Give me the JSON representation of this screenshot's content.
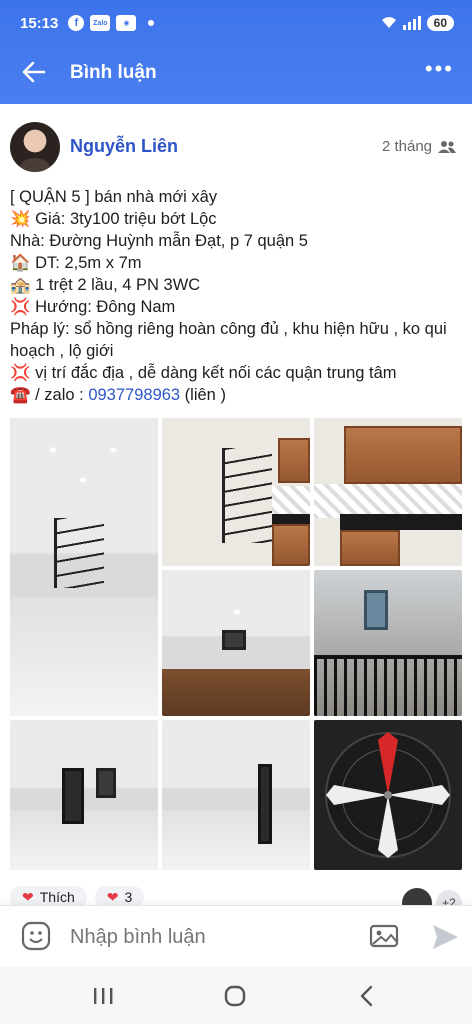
{
  "status": {
    "time": "15:13",
    "icons": [
      "facebook-icon",
      "zalo-icon",
      "camera-icon"
    ],
    "battery": "60"
  },
  "appbar": {
    "title": "Bình luận"
  },
  "post": {
    "author": "Nguyễn Liên",
    "time": "2 tháng",
    "lines": [
      "[ QUẬN 5 ] bán nhà mới xây",
      "💥 Giá: 3ty100 triệu bớt Lộc",
      "Nhà: Đường Huỳnh mẫn Đạt, p 7 quận 5",
      "🏠 DT: 2,5m x 7m",
      "🏤 1 trệt 2 lầu, 4 PN 3WC",
      "💢 Hướng: Đông Nam",
      "Pháp lý: sổ hồng riêng hoàn công đủ , khu hiện hữu , ko qui hoạch , lộ giới",
      "💢 vị trí đắc địa , dễ dàng kết nối các quận trung tâm"
    ],
    "contact_prefix": "☎️ / zalo : ",
    "phone": "0937798963",
    "contact_suffix": " (liên )"
  },
  "reactions": {
    "like_label": "Thích",
    "count": "3",
    "more_count": "+2"
  },
  "composer": {
    "placeholder": "Nhập bình luận"
  },
  "colors": {
    "accent": "#3e74ea",
    "link": "#2d55c8"
  }
}
